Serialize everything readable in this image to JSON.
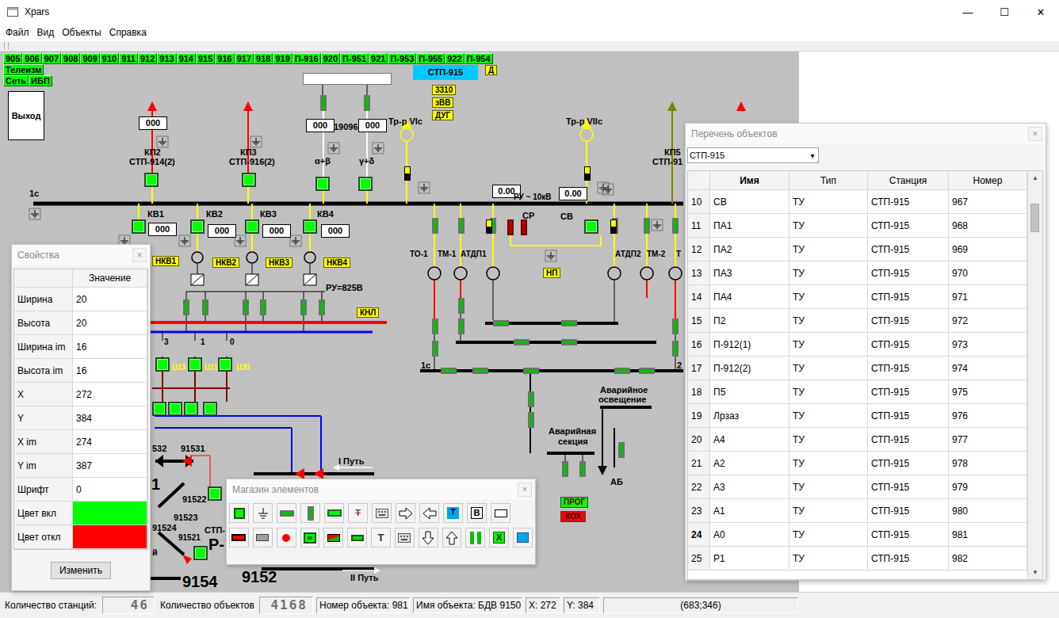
{
  "window": {
    "title": "Xpars",
    "controls": [
      "—",
      "☐",
      "✕"
    ]
  },
  "menu": [
    "Файл",
    "Вид",
    "Объекты",
    "Справка"
  ],
  "stations": {
    "buttons": [
      "905",
      "906",
      "907",
      "908",
      "909",
      "910",
      "911",
      "912",
      "913",
      "914",
      "915",
      "916",
      "917",
      "918",
      "919",
      "П-916",
      "920",
      "П-951",
      "921",
      "П-953",
      "П-955",
      "922",
      "П-954"
    ],
    "extra_rows": [
      [
        "Телеизм"
      ],
      [
        "Сеть",
        "ИБП"
      ]
    ]
  },
  "exit_button": "Выход",
  "diagram": {
    "labels": [
      {
        "text": "СТП-915",
        "kind": "blue"
      },
      {
        "text": "Д",
        "kind": "yellow"
      },
      {
        "text": "3310",
        "kind": "yellow"
      },
      {
        "text": "зВВ",
        "kind": "yellow"
      },
      {
        "text": "ДУГ",
        "kind": "yellow"
      },
      {
        "text": "000",
        "kind": "box"
      },
      {
        "text": "000",
        "kind": "box"
      },
      {
        "text": "19096",
        "kind": "text"
      },
      {
        "text": "000",
        "kind": "box"
      },
      {
        "text": "Тр-р VIс",
        "kind": "text"
      },
      {
        "text": "Тр-р VIIс",
        "kind": "text"
      },
      {
        "text": "КП2",
        "kind": "text"
      },
      {
        "text": "СТП-914(2)",
        "kind": "text"
      },
      {
        "text": "КП3",
        "kind": "text"
      },
      {
        "text": "СТП-916(2)",
        "kind": "text"
      },
      {
        "text": "α+β",
        "kind": "text"
      },
      {
        "text": "γ+δ",
        "kind": "text"
      },
      {
        "text": "КП5",
        "kind": "text"
      },
      {
        "text": "СТП-91",
        "kind": "text"
      },
      {
        "text": "1с",
        "kind": "text"
      },
      {
        "text": "0.00",
        "kind": "box"
      },
      {
        "text": "РУ ~ 10кВ",
        "kind": "small"
      },
      {
        "text": "0.00",
        "kind": "box"
      },
      {
        "text": "СР",
        "kind": "text"
      },
      {
        "text": "СВ",
        "kind": "text"
      },
      {
        "text": "КВ1",
        "kind": "text"
      },
      {
        "text": "КВ2",
        "kind": "text"
      },
      {
        "text": "КВ3",
        "kind": "text"
      },
      {
        "text": "КВ4",
        "kind": "text"
      },
      {
        "text": "000",
        "kind": "box"
      },
      {
        "text": "000",
        "kind": "box"
      },
      {
        "text": "000",
        "kind": "box"
      },
      {
        "text": "000",
        "kind": "box"
      },
      {
        "text": "НКВ1",
        "kind": "yellow"
      },
      {
        "text": "НКВ2",
        "kind": "yellow"
      },
      {
        "text": "НКВ3",
        "kind": "yellow"
      },
      {
        "text": "НКВ4",
        "kind": "yellow"
      },
      {
        "text": "ТО-1",
        "kind": "small"
      },
      {
        "text": "ТМ-1",
        "kind": "small"
      },
      {
        "text": "АТДП1",
        "kind": "small"
      },
      {
        "text": "АТДП2",
        "kind": "small"
      },
      {
        "text": "ТМ-2",
        "kind": "small"
      },
      {
        "text": "Т",
        "kind": "small"
      },
      {
        "text": "НП",
        "kind": "yellow"
      },
      {
        "text": "РУ=825В",
        "kind": "text"
      },
      {
        "text": "КНЛ",
        "kind": "yellow"
      },
      {
        "text": "3",
        "kind": "small"
      },
      {
        "text": "1",
        "kind": "small"
      },
      {
        "text": "0",
        "kind": "small"
      },
      {
        "text": "Ш3",
        "kind": "ytext"
      },
      {
        "text": "Ш1",
        "kind": "ytext"
      },
      {
        "text": "Ш0",
        "kind": "ytext"
      },
      {
        "text": "1с",
        "kind": "text"
      },
      {
        "text": "2",
        "kind": "text"
      },
      {
        "text": "Аварийное",
        "kind": "text"
      },
      {
        "text": "освещение",
        "kind": "text"
      },
      {
        "text": "Аварийная",
        "kind": "text"
      },
      {
        "text": "секция",
        "kind": "text"
      },
      {
        "text": "I Путь",
        "kind": "text"
      },
      {
        "text": "АБ",
        "kind": "text"
      },
      {
        "text": "ПРОГ",
        "kind": "green"
      },
      {
        "text": "КОХ",
        "kind": "red"
      },
      {
        "text": "532",
        "kind": "text"
      },
      {
        "text": "91531",
        "kind": "text"
      },
      {
        "text": "1",
        "kind": "big"
      },
      {
        "text": "91522",
        "kind": "text"
      },
      {
        "text": "91523",
        "kind": "text"
      },
      {
        "text": "91524",
        "kind": "text"
      },
      {
        "text": "СТП-",
        "kind": "text"
      },
      {
        "text": "91521",
        "kind": "small"
      },
      {
        "text": "Р-",
        "kind": "big"
      },
      {
        "text": "й",
        "kind": "text"
      },
      {
        "text": "9152",
        "kind": "big"
      },
      {
        "text": "II Путь",
        "kind": "text"
      },
      {
        "text": "9154",
        "kind": "big"
      }
    ],
    "switches": [
      {
        "kind": "square",
        "on": true
      },
      {
        "kind": "square",
        "on": true
      },
      {
        "kind": "square",
        "on": true
      },
      {
        "kind": "square",
        "on": true
      },
      {
        "kind": "square",
        "on": true
      },
      {
        "kind": "square",
        "on": true
      },
      {
        "kind": "square",
        "on": true
      },
      {
        "kind": "square",
        "on": true
      },
      {
        "kind": "square",
        "on": true
      },
      {
        "kind": "square",
        "on": true
      },
      {
        "kind": "square",
        "on": true
      },
      {
        "kind": "square",
        "on": true
      },
      {
        "kind": "square",
        "on": true
      },
      {
        "kind": "square",
        "on": true
      },
      {
        "kind": "square",
        "on": true
      },
      {
        "kind": "square",
        "on": true
      },
      {
        "kind": "square",
        "on": true
      },
      {
        "kind": "square",
        "on": true
      },
      {
        "kind": "vertical",
        "on": true
      },
      {
        "kind": "vertical",
        "on": true
      },
      {
        "kind": "vertical",
        "on": true
      },
      {
        "kind": "vertical",
        "on": true
      },
      {
        "kind": "vertical",
        "on": true
      },
      {
        "kind": "vertical",
        "on": true
      },
      {
        "kind": "vertical",
        "on": true
      },
      {
        "kind": "vertical",
        "on": true
      },
      {
        "kind": "vertical",
        "on": true
      },
      {
        "kind": "vertical",
        "on": true
      },
      {
        "kind": "vertical",
        "on": true
      },
      {
        "kind": "vertical",
        "on": true
      },
      {
        "kind": "vertical",
        "on": true
      },
      {
        "kind": "vertical",
        "on": true
      },
      {
        "kind": "vertical",
        "on": true
      },
      {
        "kind": "vertical",
        "on": true
      },
      {
        "kind": "vertical",
        "on": true
      },
      {
        "kind": "vertical",
        "on": true
      },
      {
        "kind": "vertical",
        "on": true
      },
      {
        "kind": "vertical",
        "on": true
      },
      {
        "kind": "vertical",
        "on": true
      },
      {
        "kind": "vertical",
        "on": true
      },
      {
        "kind": "vertical",
        "on": true
      },
      {
        "kind": "vertical",
        "on": true
      },
      {
        "kind": "horizontal",
        "on": true
      },
      {
        "kind": "horizontal",
        "on": true
      },
      {
        "kind": "horizontal",
        "on": true
      },
      {
        "kind": "horizontal",
        "on": true
      },
      {
        "kind": "horizontal",
        "on": true
      },
      {
        "kind": "horizontal",
        "on": true
      },
      {
        "kind": "horizontal",
        "on": true
      },
      {
        "kind": "horizontal",
        "on": true
      },
      {
        "kind": "horizontal",
        "on": true
      },
      {
        "kind": "fuse",
        "on": true
      },
      {
        "kind": "fuse",
        "on": true
      },
      {
        "kind": "fuse",
        "on": true
      },
      {
        "kind": "fuse",
        "on": true
      },
      {
        "kind": "vertical",
        "on": false
      },
      {
        "kind": "vertical",
        "on": false
      },
      {
        "kind": "vertical",
        "on": true
      }
    ]
  },
  "properties": {
    "title": "Свойства",
    "close": "×",
    "columns": [
      "",
      "Значение"
    ],
    "rows": [
      {
        "label": "Ширина",
        "kind": "text",
        "value": "20"
      },
      {
        "label": "Высота",
        "kind": "text",
        "value": "20"
      },
      {
        "label": "Ширина im",
        "kind": "text",
        "value": "16"
      },
      {
        "label": "Высота im",
        "kind": "text",
        "value": "16"
      },
      {
        "label": "X",
        "kind": "text",
        "value": "272"
      },
      {
        "label": "Y",
        "kind": "text",
        "value": "384"
      },
      {
        "label": "X im",
        "kind": "text",
        "value": "274"
      },
      {
        "label": "Y im",
        "kind": "text",
        "value": "387"
      },
      {
        "label": "Шрифт",
        "kind": "text",
        "value": "0"
      },
      {
        "label": "Цвет вкл",
        "kind": "color",
        "color": "#00ff00"
      },
      {
        "label": "Цвет откл",
        "kind": "color",
        "color": "#ff0000"
      }
    ],
    "button": "Изменить"
  },
  "palette": {
    "title": "Магазин элементов",
    "close": "×",
    "rows": [
      [
        {
          "kind": "green-square"
        },
        {
          "kind": "ground"
        },
        {
          "kind": "h-bar"
        },
        {
          "kind": "v-bar"
        },
        {
          "kind": "h-bar-green"
        },
        {
          "kind": "tu",
          "glyph": "Т"
        },
        {
          "kind": "keyboard"
        },
        {
          "kind": "arrow-right"
        },
        {
          "kind": "arrow-left"
        },
        {
          "kind": "text-blue",
          "glyph": "Т"
        },
        {
          "kind": "text-box",
          "glyph": "В"
        },
        {
          "kind": "rect"
        }
      ],
      [
        {
          "kind": "red-bar"
        },
        {
          "kind": "gray-box"
        },
        {
          "kind": "red-dot"
        },
        {
          "kind": "green-frame"
        },
        {
          "kind": "red-green"
        },
        {
          "kind": "green-bar-small"
        },
        {
          "kind": "text-plain",
          "glyph": "Т"
        },
        {
          "kind": "keyboard"
        },
        {
          "kind": "arrow-down"
        },
        {
          "kind": "arrow-up"
        },
        {
          "kind": "two-bars"
        },
        {
          "kind": "x-box",
          "glyph": "Х"
        },
        {
          "kind": "blue-square"
        }
      ]
    ]
  },
  "objects": {
    "title": "Перечень объектов",
    "close": "×",
    "station": "СТП-915",
    "dropdown_arrow": "▾",
    "columns": [
      {
        "label": "",
        "sorted": false
      },
      {
        "label": "Имя",
        "sorted": true
      },
      {
        "label": "Тип",
        "sorted": false
      },
      {
        "label": "Станция",
        "sorted": false
      },
      {
        "label": "Номер",
        "sorted": false
      }
    ],
    "scroll_arrows": [
      "▲",
      "▼"
    ],
    "rows": [
      {
        "n": "10",
        "name": "СВ",
        "type": "ТУ",
        "station": "СТП-915",
        "number": "967",
        "selected": false
      },
      {
        "n": "11",
        "name": "ПА1",
        "type": "ТУ",
        "station": "СТП-915",
        "number": "968",
        "selected": false
      },
      {
        "n": "12",
        "name": "ПА2",
        "type": "ТУ",
        "station": "СТП-915",
        "number": "969",
        "selected": false
      },
      {
        "n": "13",
        "name": "ПА3",
        "type": "ТУ",
        "station": "СТП-915",
        "number": "970",
        "selected": false
      },
      {
        "n": "14",
        "name": "ПА4",
        "type": "ТУ",
        "station": "СТП-915",
        "number": "971",
        "selected": false
      },
      {
        "n": "15",
        "name": "П2",
        "type": "ТУ",
        "station": "СТП-915",
        "number": "972",
        "selected": false
      },
      {
        "n": "16",
        "name": "П-912(1)",
        "type": "ТУ",
        "station": "СТП-915",
        "number": "973",
        "selected": false
      },
      {
        "n": "17",
        "name": "П-912(2)",
        "type": "ТУ",
        "station": "СТП-915",
        "number": "974",
        "selected": false
      },
      {
        "n": "18",
        "name": "П5",
        "type": "ТУ",
        "station": "СТП-915",
        "number": "975",
        "selected": false
      },
      {
        "n": "19",
        "name": "Лрзаз",
        "type": "ТУ",
        "station": "СТП-915",
        "number": "976",
        "selected": false
      },
      {
        "n": "20",
        "name": "А4",
        "type": "ТУ",
        "station": "СТП-915",
        "number": "977",
        "selected": false
      },
      {
        "n": "21",
        "name": "А2",
        "type": "ТУ",
        "station": "СТП-915",
        "number": "978",
        "selected": false
      },
      {
        "n": "22",
        "name": "А3",
        "type": "ТУ",
        "station": "СТП-915",
        "number": "979",
        "selected": false
      },
      {
        "n": "23",
        "name": "А1",
        "type": "ТУ",
        "station": "СТП-915",
        "number": "980",
        "selected": false
      },
      {
        "n": "24",
        "name": "А0",
        "type": "ТУ",
        "station": "СТП-915",
        "number": "981",
        "selected": true
      },
      {
        "n": "25",
        "name": "Р1",
        "type": "ТУ",
        "station": "СТП-915",
        "number": "982",
        "selected": false
      }
    ]
  },
  "status_bar": {
    "stations_label": "Количество станций:",
    "stations": "46",
    "objects_label": "Количество объектов",
    "objects": "4168",
    "object_number": "Номер объекта: 981",
    "object_name": "Имя объекта: БДВ 9150",
    "x": "X: 272",
    "y": "Y: 384",
    "cursor": "(683;346)"
  }
}
